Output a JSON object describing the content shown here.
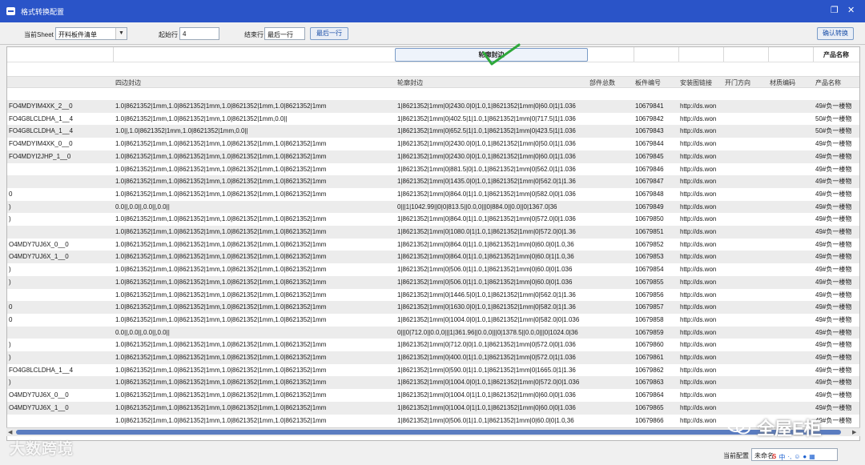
{
  "window": {
    "title": "格式转换配置"
  },
  "toolbar": {
    "sheet_label": "当前Sheet",
    "sheet_value": "开料板件清单",
    "start_label": "起始行",
    "start_value": "4",
    "end_label": "结束行",
    "end_value": "最后一行",
    "last_row_button": "最后一行",
    "confirm_button": "确认转换"
  },
  "grid": {
    "merged_button": "轮廓封边",
    "top_right_label": "产品名称",
    "headers": [
      "四边封边",
      "轮廓封边",
      "部件总数",
      "板件编号",
      "安装图链接",
      "开门方向",
      "材质编码",
      "产品名称"
    ],
    "rows": [
      [
        "FO4MDYIM4XK_2__0",
        "1.0|8621352|1mm,1.0|8621352|1mm,1.0|8621352|1mm,1.0|8621352|1mm",
        "1|8621352|1mm|0|2430.0|0|1.0,1|8621352|1mm|0|60.0|1|1.036",
        "10679841",
        "http://ds.won",
        "49#负一楼物"
      ],
      [
        "FO4G8LCLDHA_1__4",
        "1.0|8621352|1mm,1.0|8621352|1mm,1.0|8621352|1mm,0.0||",
        "1|8621352|1mm|0|402.5|1|1.0,1|8621352|1mm|0|717.5|1|1.036",
        "10679842",
        "http://ds.won",
        "50#负一楼物"
      ],
      [
        "FO4G8LCLDHA_1__4",
        "1.0||,1.0|8621352|1mm,1.0|8621352|1mm,0.0||",
        "1|8621352|1mm|0|652.5|1|1.0,1|8621352|1mm|0|423.5|1|1.036",
        "10679843",
        "http://ds.won",
        "50#负一楼物"
      ],
      [
        "FO4MDYIM4XK_0__0",
        "1.0|8621352|1mm,1.0|8621352|1mm,1.0|8621352|1mm,1.0|8621352|1mm",
        "1|8621352|1mm|0|2430.0|0|1.0,1|8621352|1mm|0|50.0|1|1.036",
        "10679844",
        "http://ds.won",
        "49#负一楼物"
      ],
      [
        "FO4MDYI2JHP_1__0",
        "1.0|8621352|1mm,1.0|8621352|1mm,1.0|8621352|1mm,1.0|8621352|1mm",
        "1|8621352|1mm|0|2430.0|0|1.0,1|8621352|1mm|0|60.0|1|1.036",
        "10679845",
        "http://ds.won",
        "49#负一楼物"
      ],
      [
        "",
        "1.0|8621352|1mm,1.0|8621352|1mm,1.0|8621352|1mm,1.0|8621352|1mm",
        "1|8621352|1mm|0|881.5|0|1.0,1|8621352|1mm|0|562.0|1|1.036",
        "10679846",
        "http://ds.won",
        "49#负一楼物"
      ],
      [
        "",
        "1.0|8621352|1mm,1.0|8621352|1mm,1.0|8621352|1mm,1.0|8621352|1mm",
        "1|8621352|1mm|0|1435.0|0|1.0,1|8621352|1mm|0|562.0|1|1.36",
        "10679847",
        "http://ds.won",
        "49#负一楼物"
      ],
      [
        "0",
        "1.0|8621352|1mm,1.0|8621352|1mm,1.0|8621352|1mm,1.0|8621352|1mm",
        "1|8621352|1mm|0|864.0|1|1.0,1|8621352|1mm|0|582.0|0|1.036",
        "10679848",
        "http://ds.won",
        "49#负一楼物"
      ],
      [
        ")",
        "0.0||,0.0||,0.0||,0.0||",
        "0|||1|1042.99||0|0|813.5||0.0,0|||0|884.0||0.0||0|1367.0|36",
        "10679849",
        "http://ds.won",
        "49#负一楼物"
      ],
      [
        ")",
        "1.0|8621352|1mm,1.0|8621352|1mm,1.0|8621352|1mm,1.0|8621352|1mm",
        "1|8621352|1mm|0|864.0|1|1.0,1|8621352|1mm|0|572.0|0|1.036",
        "10679850",
        "http://ds.won",
        "49#负一楼物"
      ],
      [
        "",
        "1.0|8621352|1mm,1.0|8621352|1mm,1.0|8621352|1mm,1.0|8621352|1mm",
        "1|8621352|1mm|0|1080.0|1|1.0,1|8621352|1mm|0|572.0|0|1.36",
        "10679851",
        "http://ds.won",
        "49#负一楼物"
      ],
      [
        "O4MDY7UJ6X_0__0",
        "1.0|8621352|1mm,1.0|8621352|1mm,1.0|8621352|1mm,1.0|8621352|1mm",
        "1|8621352|1mm|0|864.0|1|1.0,1|8621352|1mm|0|60.0|0|1.0,36",
        "10679852",
        "http://ds.won",
        "49#负一楼物"
      ],
      [
        "O4MDY7UJ6X_1__0",
        "1.0|8621352|1mm,1.0|8621352|1mm,1.0|8621352|1mm,1.0|8621352|1mm",
        "1|8621352|1mm|0|864.0|1|1.0,1|8621352|1mm|0|60.0|1|1.0,36",
        "10679853",
        "http://ds.won",
        "49#负一楼物"
      ],
      [
        ")",
        "1.0|8621352|1mm,1.0|8621352|1mm,1.0|8621352|1mm,1.0|8621352|1mm",
        "1|8621352|1mm|0|506.0|1|1.0,1|8621352|1mm|0|60.0|0|1.036",
        "10679854",
        "http://ds.won",
        "49#负一楼物"
      ],
      [
        ")",
        "1.0|8621352|1mm,1.0|8621352|1mm,1.0|8621352|1mm,1.0|8621352|1mm",
        "1|8621352|1mm|0|506.0|1|1.0,1|8621352|1mm|0|60.0|0|1.036",
        "10679855",
        "http://ds.won",
        "49#负一楼物"
      ],
      [
        "",
        "1.0|8621352|1mm,1.0|8621352|1mm,1.0|8621352|1mm,1.0|8621352|1mm",
        "1|8621352|1mm|0|1446.5|0|1.0,1|8621352|1mm|0|562.0|1|1.36",
        "10679856",
        "http://ds.won",
        "49#负一楼物"
      ],
      [
        "0",
        "1.0|8621352|1mm,1.0|8621352|1mm,1.0|8621352|1mm,1.0|8621352|1mm",
        "1|8621352|1mm|0|1630.0|0|1.0,1|8621352|1mm|0|582.0|1|1.36",
        "10679857",
        "http://ds.won",
        "49#负一楼物"
      ],
      [
        "0",
        "1.0|8621352|1mm,1.0|8621352|1mm,1.0|8621352|1mm,1.0|8621352|1mm",
        "1|8621352|1mm|0|1004.0|0|1.0,1|8621352|1mm|0|582.0|0|1.036",
        "10679858",
        "http://ds.won",
        "49#负一楼物"
      ],
      [
        "",
        "0.0||,0.0||,0.0||,0.0||",
        "0|||0|712.0||0.0,0|||1|361.96||0.0,0|||0|1378.5||0.0,0|||0|1024.0|36",
        "10679859",
        "http://ds.won",
        "49#负一楼物"
      ],
      [
        ")",
        "1.0|8621352|1mm,1.0|8621352|1mm,1.0|8621352|1mm,1.0|8621352|1mm",
        "1|8621352|1mm|0|712.0|0|1.0,1|8621352|1mm|0|572.0|0|1.036",
        "10679860",
        "http://ds.won",
        "49#负一楼物"
      ],
      [
        ")",
        "1.0|8621352|1mm,1.0|8621352|1mm,1.0|8621352|1mm,1.0|8621352|1mm",
        "1|8621352|1mm|0|400.0|1|1.0,1|8621352|1mm|0|572.0|1|1.036",
        "10679861",
        "http://ds.won",
        "49#负一楼物"
      ],
      [
        "FO4G8LCLDHA_1__4",
        "1.0|8621352|1mm,1.0|8621352|1mm,1.0|8621352|1mm,1.0|8621352|1mm",
        "1|8621352|1mm|0|590.0|1|1.0,1|8621352|1mm|0|1665.0|1|1.36",
        "10679862",
        "http://ds.won",
        "49#负一楼物"
      ],
      [
        ")",
        "1.0|8621352|1mm,1.0|8621352|1mm,1.0|8621352|1mm,1.0|8621352|1mm",
        "1|8621352|1mm|0|1004.0|0|1.0,1|8621352|1mm|0|572.0|0|1.036",
        "10679863",
        "http://ds.won",
        "49#负一楼物"
      ],
      [
        "O4MDY7UJ6X_0__0",
        "1.0|8621352|1mm,1.0|8621352|1mm,1.0|8621352|1mm,1.0|8621352|1mm",
        "1|8621352|1mm|0|1004.0|1|1.0,1|8621352|1mm|0|60.0|0|1.036",
        "10679864",
        "http://ds.won",
        "49#负一楼物"
      ],
      [
        "O4MDY7UJ6X_1__0",
        "1.0|8621352|1mm,1.0|8621352|1mm,1.0|8621352|1mm,1.0|8621352|1mm",
        "1|8621352|1mm|0|1004.0|1|1.0,1|8621352|1mm|0|60.0|0|1.036",
        "10679865",
        "http://ds.won",
        "49#负一楼物"
      ],
      [
        "",
        "1.0|8621352|1mm,1.0|8621352|1mm,1.0|8621352|1mm,1.0|8621352|1mm",
        "1|8621352|1mm|0|506.0|1|1.0,1|8621352|1mm|0|60.0|0|1.0,36",
        "10679866",
        "http://ds.won",
        "49#负一楼物"
      ]
    ]
  },
  "status": {
    "current_config_label": "当前配置",
    "current_config_value": "未命名"
  },
  "watermarks": {
    "left": "大数跨境",
    "right": "全屋E柜"
  },
  "colors": {
    "titlebar": "#2a54c8",
    "row_alt": "#ececec",
    "accent": "#7a9cc8"
  }
}
